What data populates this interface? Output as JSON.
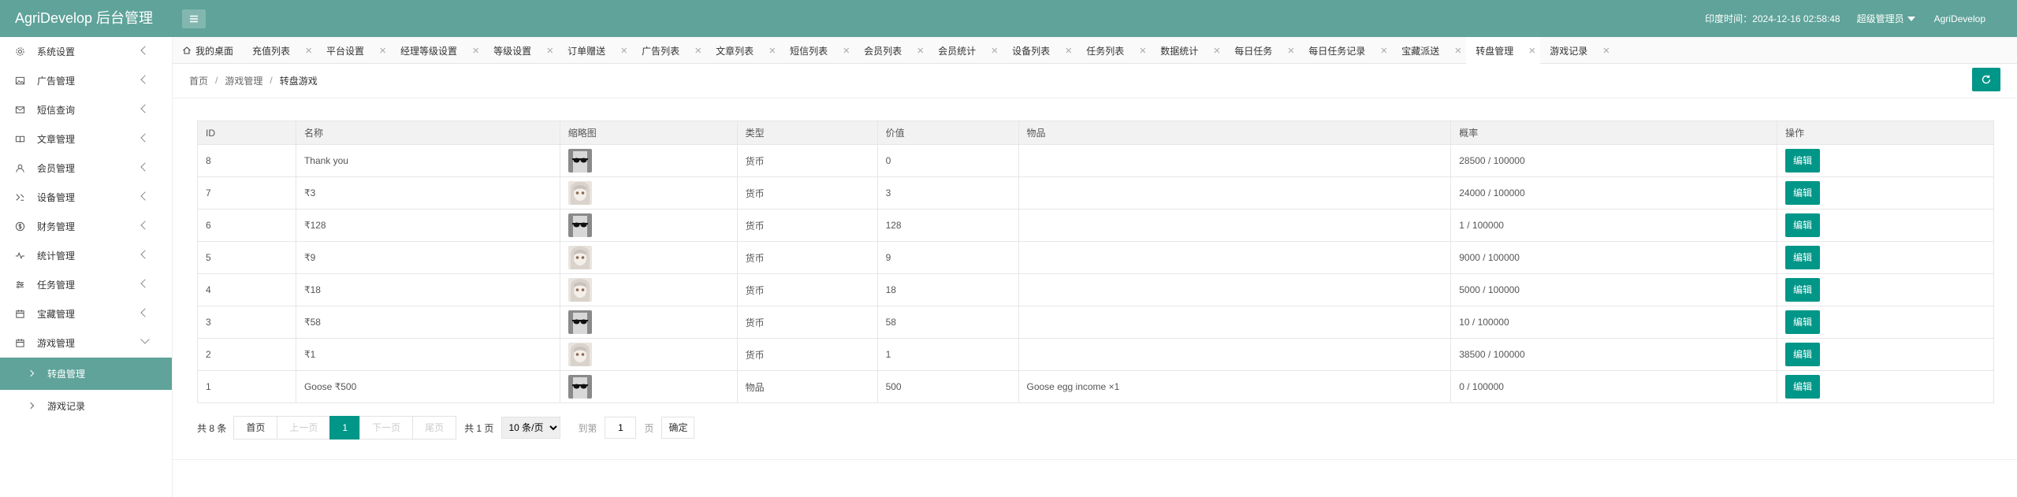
{
  "header": {
    "title": "AgriDevelop 后台管理",
    "time_text": "印度时间：2024-12-16 02:58:48",
    "user_role": "超级管理员",
    "site_name": "AgriDevelop",
    "bg_color": "#5fa39a"
  },
  "sidebar": {
    "items": [
      {
        "label": "系统设置",
        "icon": "gear-icon"
      },
      {
        "label": "广告管理",
        "icon": "image-icon"
      },
      {
        "label": "短信查询",
        "icon": "message-icon"
      },
      {
        "label": "文章管理",
        "icon": "book-icon"
      },
      {
        "label": "会员管理",
        "icon": "user-icon"
      },
      {
        "label": "设备管理",
        "icon": "device-icon"
      },
      {
        "label": "财务管理",
        "icon": "dollar-icon"
      },
      {
        "label": "统计管理",
        "icon": "pulse-icon"
      },
      {
        "label": "任务管理",
        "icon": "sliders-icon"
      },
      {
        "label": "宝藏管理",
        "icon": "calendar-icon"
      },
      {
        "label": "游戏管理",
        "icon": "calendar-icon"
      }
    ],
    "sub_items": [
      {
        "label": "转盘管理",
        "active": true
      },
      {
        "label": "游戏记录",
        "active": false
      }
    ]
  },
  "tabs": [
    {
      "label": "我的桌面",
      "home": true
    },
    {
      "label": "充值列表"
    },
    {
      "label": "平台设置"
    },
    {
      "label": "经理等级设置"
    },
    {
      "label": "等级设置"
    },
    {
      "label": "订单赠送"
    },
    {
      "label": "广告列表"
    },
    {
      "label": "文章列表"
    },
    {
      "label": "短信列表"
    },
    {
      "label": "会员列表"
    },
    {
      "label": "会员统计"
    },
    {
      "label": "设备列表"
    },
    {
      "label": "任务列表"
    },
    {
      "label": "数据统计"
    },
    {
      "label": "每日任务"
    },
    {
      "label": "每日任务记录"
    },
    {
      "label": "宝藏派送"
    },
    {
      "label": "转盘管理",
      "active": true
    },
    {
      "label": "游戏记录"
    }
  ],
  "breadcrumb": {
    "home": "首页",
    "parent": "游戏管理",
    "current": "转盘游戏"
  },
  "table": {
    "headers": [
      "ID",
      "名称",
      "缩略图",
      "类型",
      "价值",
      "物品",
      "概率",
      "操作"
    ],
    "rows": [
      {
        "id": "8",
        "name": "Thank you",
        "thumb": "sunglasses",
        "type": "货币",
        "type_kind": "coin",
        "value": "0",
        "item": "",
        "prob": "28500 / 100000",
        "action": "编辑"
      },
      {
        "id": "7",
        "name": "₹3",
        "thumb": "anime",
        "type": "货币",
        "type_kind": "coin",
        "value": "3",
        "item": "",
        "prob": "24000 / 100000",
        "action": "编辑"
      },
      {
        "id": "6",
        "name": "₹128",
        "thumb": "sunglasses",
        "type": "货币",
        "type_kind": "coin",
        "value": "128",
        "item": "",
        "prob": "1 / 100000",
        "action": "编辑"
      },
      {
        "id": "5",
        "name": "₹9",
        "thumb": "anime",
        "type": "货币",
        "type_kind": "coin",
        "value": "9",
        "item": "",
        "prob": "9000 / 100000",
        "action": "编辑"
      },
      {
        "id": "4",
        "name": "₹18",
        "thumb": "anime",
        "type": "货币",
        "type_kind": "coin",
        "value": "18",
        "item": "",
        "prob": "5000 / 100000",
        "action": "编辑"
      },
      {
        "id": "3",
        "name": "₹58",
        "thumb": "sunglasses",
        "type": "货币",
        "type_kind": "coin",
        "value": "58",
        "item": "",
        "prob": "10 / 100000",
        "action": "编辑"
      },
      {
        "id": "2",
        "name": "₹1",
        "thumb": "anime",
        "type": "货币",
        "type_kind": "coin",
        "value": "1",
        "item": "",
        "prob": "38500 / 100000",
        "action": "编辑"
      },
      {
        "id": "1",
        "name": "Goose ₹500",
        "thumb": "sunglasses",
        "type": "物品",
        "type_kind": "item",
        "value": "500",
        "item": "Goose egg income ×1",
        "prob": "0 / 100000",
        "action": "编辑"
      }
    ]
  },
  "pager": {
    "count": "共 8 条",
    "first": "首页",
    "prev": "上一页",
    "current": "1",
    "next": "下一页",
    "last": "尾页",
    "total": "共 1 页",
    "per_page": "10 条/页",
    "goto_label": "到第",
    "goto_value": "1",
    "unit": "页",
    "confirm": "确定"
  },
  "colors": {
    "accent": "#009688",
    "coin": "#4caf50",
    "item": "#c0392b"
  }
}
